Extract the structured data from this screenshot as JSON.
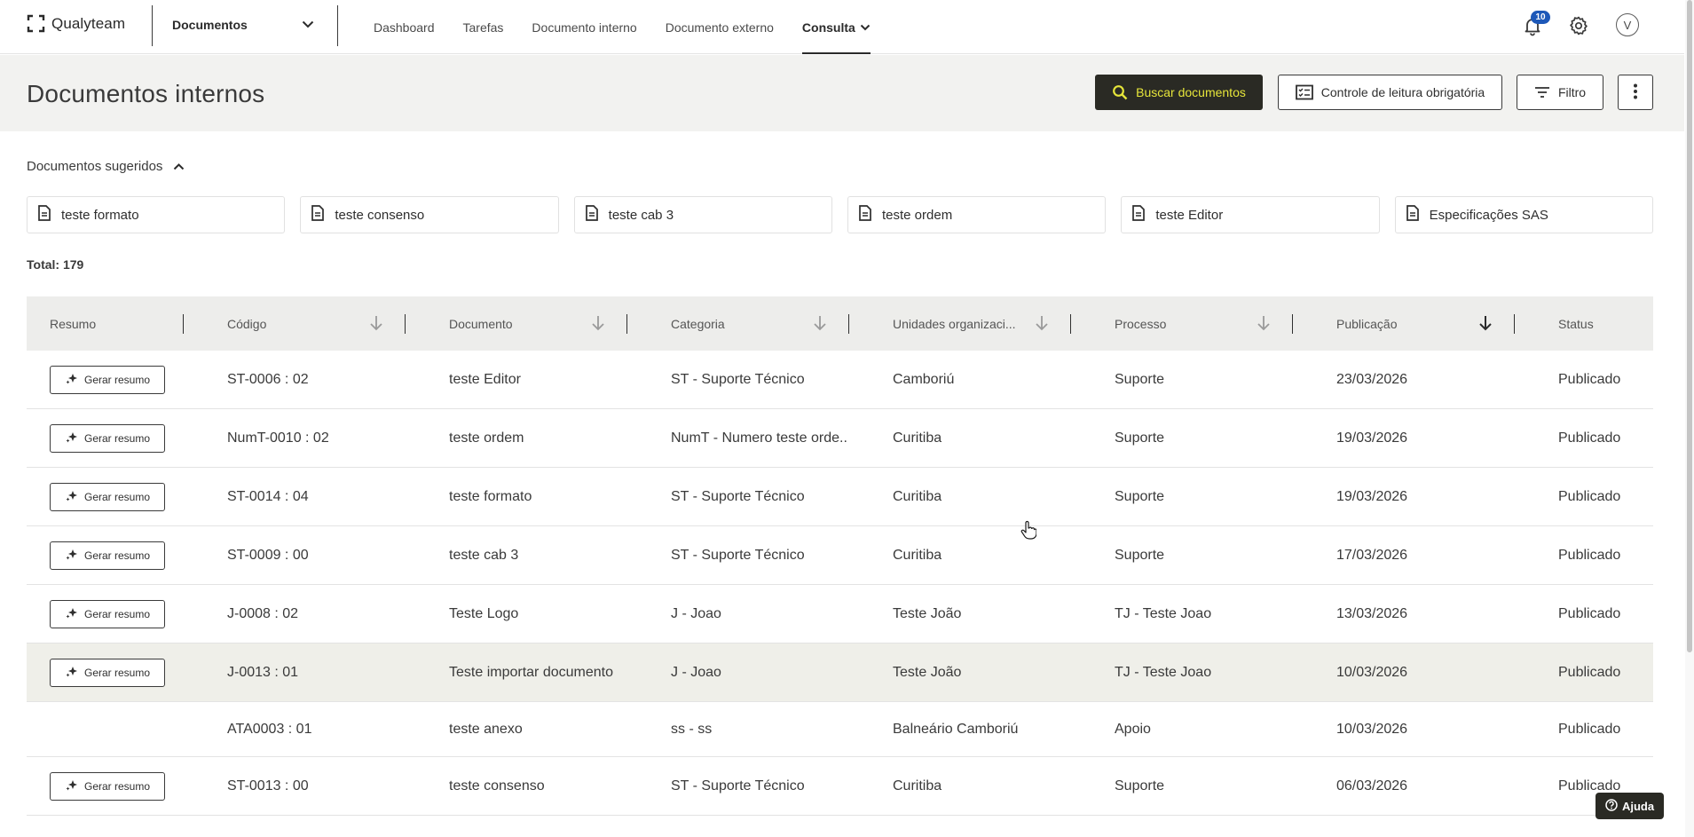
{
  "app": {
    "name": "Qualyteam",
    "module": "Documentos"
  },
  "nav": {
    "items": [
      {
        "label": "Dashboard"
      },
      {
        "label": "Tarefas"
      },
      {
        "label": "Documento interno"
      },
      {
        "label": "Documento externo"
      },
      {
        "label": "Consulta",
        "active": true
      }
    ]
  },
  "header_icons": {
    "notifications_count": "10",
    "avatar_initial": "V"
  },
  "page": {
    "title": "Documentos internos",
    "search_label": "Buscar documentos",
    "reading_label": "Controle de leitura obrigatória",
    "filter_label": "Filtro"
  },
  "suggested": {
    "title": "Documentos sugeridos",
    "items": [
      "teste formato",
      "teste consenso",
      "teste cab 3",
      "teste ordem",
      "teste Editor",
      "Especificações SAS"
    ]
  },
  "total": "Total: 179",
  "table": {
    "columns": [
      "Resumo",
      "Código",
      "Documento",
      "Categoria",
      "Unidades organizaci...",
      "Processo",
      "Publicação",
      "Status"
    ],
    "summary_button": "Gerar resumo",
    "rows": [
      {
        "codigo": "ST-0006 : 02",
        "documento": "teste Editor",
        "categoria": "ST - Suporte Técnico",
        "unidade": "Camboriú",
        "processo": "Suporte",
        "publicacao": "23/03/2026",
        "status": "Publicado",
        "resumo": true
      },
      {
        "codigo": "NumT-0010 : 02",
        "documento": "teste ordem",
        "categoria": "NumT - Numero teste orde...",
        "unidade": "Curitiba",
        "processo": "Suporte",
        "publicacao": "19/03/2026",
        "status": "Publicado",
        "resumo": true
      },
      {
        "codigo": "ST-0014 : 04",
        "documento": "teste formato",
        "categoria": "ST - Suporte Técnico",
        "unidade": "Curitiba",
        "processo": "Suporte",
        "publicacao": "19/03/2026",
        "status": "Publicado",
        "resumo": true
      },
      {
        "codigo": "ST-0009 : 00",
        "documento": "teste cab 3",
        "categoria": "ST - Suporte Técnico",
        "unidade": "Curitiba",
        "processo": "Suporte",
        "publicacao": "17/03/2026",
        "status": "Publicado",
        "resumo": true
      },
      {
        "codigo": "J-0008 : 02",
        "documento": "Teste Logo",
        "categoria": "J - Joao",
        "unidade": "Teste João",
        "processo": "TJ - Teste Joao",
        "publicacao": "13/03/2026",
        "status": "Publicado",
        "resumo": true
      },
      {
        "codigo": "J-0013 : 01",
        "documento": "Teste importar documento",
        "categoria": "J - Joao",
        "unidade": "Teste João",
        "processo": "TJ - Teste Joao",
        "publicacao": "10/03/2026",
        "status": "Publicado",
        "resumo": true,
        "highlighted": true
      },
      {
        "codigo": "ATA0003 : 01",
        "documento": "teste anexo",
        "categoria": "ss - ss",
        "unidade": "Balneário Camboriú",
        "processo": "Apoio",
        "publicacao": "10/03/2026",
        "status": "Publicado",
        "resumo": false
      },
      {
        "codigo": "ST-0013 : 00",
        "documento": "teste consenso",
        "categoria": "ST - Suporte Técnico",
        "unidade": "Curitiba",
        "processo": "Suporte",
        "publicacao": "06/03/2026",
        "status": "Publicado",
        "resumo": true
      }
    ]
  },
  "help": {
    "label": "Ajuda"
  }
}
